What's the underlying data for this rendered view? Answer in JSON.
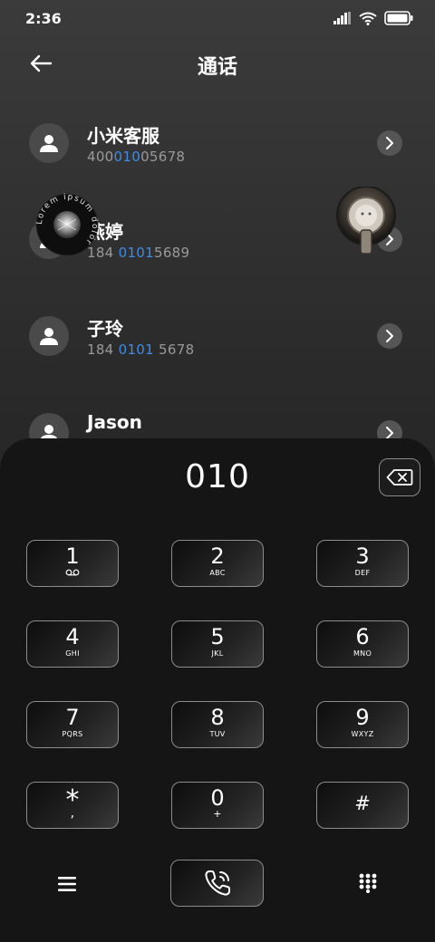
{
  "status_bar": {
    "time": "2:36"
  },
  "header": {
    "title": "通话"
  },
  "contacts": [
    {
      "name": "小米客服",
      "number_parts": [
        "400",
        "010",
        "05678"
      ]
    },
    {
      "name": "燕婷",
      "number_parts": [
        "184 ",
        "0101",
        "5689"
      ]
    },
    {
      "name": "子玲",
      "number_parts": [
        "184 ",
        "0101",
        " 5678"
      ]
    },
    {
      "name": "Jason",
      "number_parts": [
        "",
        "",
        ""
      ]
    }
  ],
  "sticker": {
    "text": "Lorem ipsum dolor"
  },
  "dialer": {
    "input_value": "010",
    "keys": [
      {
        "digit": "1",
        "letters": ""
      },
      {
        "digit": "2",
        "letters": "ABC"
      },
      {
        "digit": "3",
        "letters": "DEF"
      },
      {
        "digit": "4",
        "letters": "GHI"
      },
      {
        "digit": "5",
        "letters": "JKL"
      },
      {
        "digit": "6",
        "letters": "MNO"
      },
      {
        "digit": "7",
        "letters": "PQRS"
      },
      {
        "digit": "8",
        "letters": "TUV"
      },
      {
        "digit": "9",
        "letters": "WXYZ"
      },
      {
        "digit": "*",
        "letters": ","
      },
      {
        "digit": "0",
        "letters": "+"
      },
      {
        "digit": "#",
        "letters": ""
      }
    ]
  },
  "icons": {
    "back": "back-arrow-icon",
    "arrow": "chevron-right-icon",
    "backspace": "backspace-icon",
    "menu": "menu-icon",
    "call": "phone-call-icon",
    "keypad": "keypad-icon",
    "voicemail": "voicemail-icon"
  },
  "colors": {
    "highlight": "#3f8ce6",
    "dialer_bg": "#151515"
  }
}
